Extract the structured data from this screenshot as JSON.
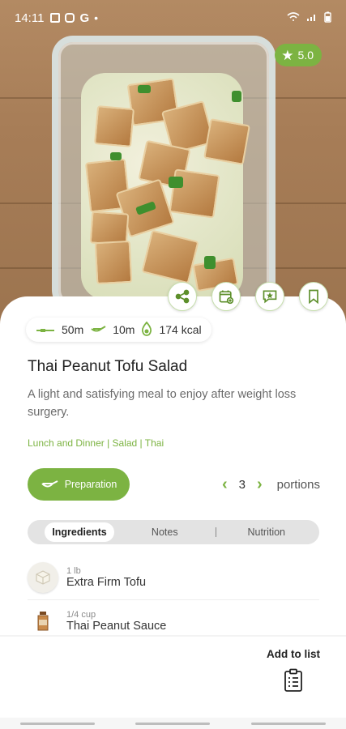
{
  "status_bar": {
    "time": "14:11",
    "extra": "G"
  },
  "rating": {
    "value": "5.0"
  },
  "meta": {
    "total_time": "50m",
    "prep_time": "10m",
    "calories": "174 kcal"
  },
  "recipe": {
    "title": "Thai Peanut Tofu Salad",
    "description": "A light and satisfying meal to enjoy after weight loss surgery.",
    "tags": "Lunch and Dinner | Salad | Thai"
  },
  "preparation_button": "Preparation",
  "portions": {
    "count": "3",
    "label": "portions"
  },
  "tabs": [
    {
      "label": "Ingredients",
      "active": true
    },
    {
      "label": "Notes",
      "active": false
    },
    {
      "label": "Nutrition",
      "active": false
    }
  ],
  "ingredients": [
    {
      "qty": "1 lb",
      "name": "Extra Firm Tofu",
      "icon": "tofu-icon"
    },
    {
      "qty": "1/4 cup",
      "name": "Thai Peanut Sauce",
      "icon": "sauce-jar-icon"
    }
  ],
  "add_to_list": "Add to list",
  "colors": {
    "accent": "#7cb342",
    "accent_dark": "#5d8f2b",
    "tab_bg": "#e3e3e3"
  }
}
